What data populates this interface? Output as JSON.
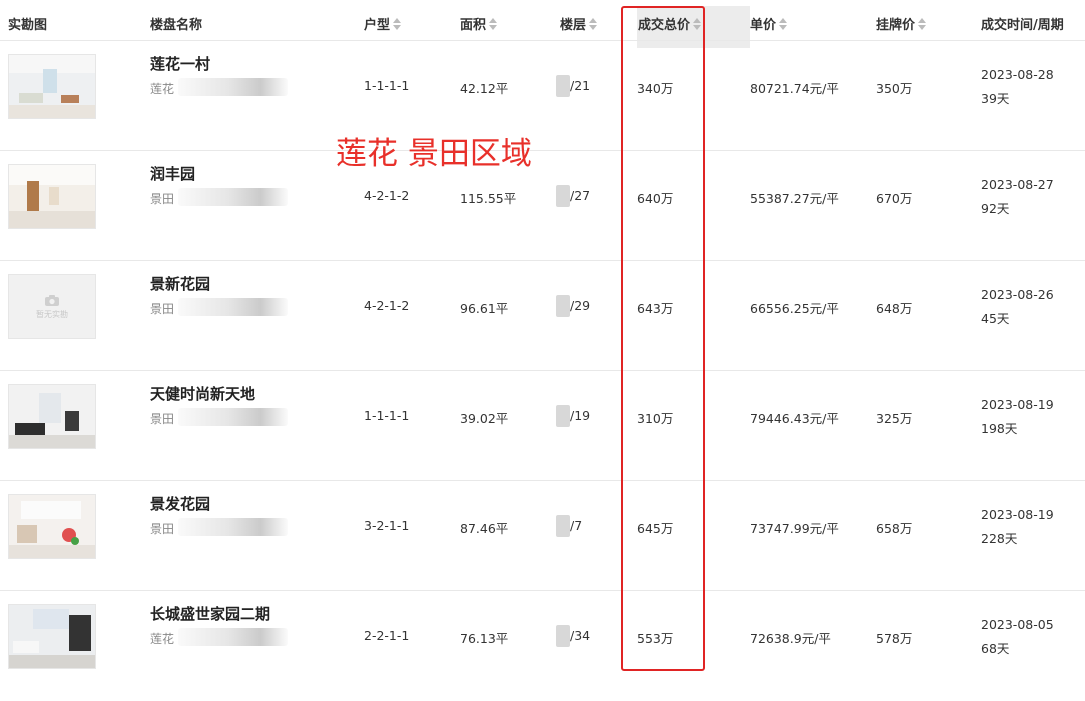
{
  "header": {
    "photo": "实勘图",
    "name": "楼盘名称",
    "layout": "户型",
    "area": "面积",
    "floor": "楼层",
    "total_price": "成交总价",
    "unit_price": "单价",
    "list_price": "挂牌价",
    "deal_time": "成交时间/周期"
  },
  "annotation": "莲花 景田区域",
  "rows": [
    {
      "name": "莲花一村",
      "district": "莲花",
      "layout": "1-1-1-1",
      "area": "42.12平",
      "floor": "/21",
      "total": "340万",
      "unit": "80721.74元/平",
      "list": "350万",
      "date": "2023-08-28",
      "cycle": "39天",
      "photo": "room"
    },
    {
      "name": "润丰园",
      "district": "景田",
      "layout": "4-2-1-2",
      "area": "115.55平",
      "floor": "/27",
      "total": "640万",
      "unit": "55387.27元/平",
      "list": "670万",
      "date": "2023-08-27",
      "cycle": "92天",
      "photo": "room"
    },
    {
      "name": "景新花园",
      "district": "景田",
      "layout": "4-2-1-2",
      "area": "96.61平",
      "floor": "/29",
      "total": "643万",
      "unit": "66556.25元/平",
      "list": "648万",
      "date": "2023-08-26",
      "cycle": "45天",
      "photo": "none",
      "no_photo_text": "暂无实勘"
    },
    {
      "name": "天健时尚新天地",
      "district": "景田",
      "layout": "1-1-1-1",
      "area": "39.02平",
      "floor": "/19",
      "total": "310万",
      "unit": "79446.43元/平",
      "list": "325万",
      "date": "2023-08-19",
      "cycle": "198天",
      "photo": "room"
    },
    {
      "name": "景发花园",
      "district": "景田",
      "layout": "3-2-1-1",
      "area": "87.46平",
      "floor": "/7",
      "total": "645万",
      "unit": "73747.99元/平",
      "list": "658万",
      "date": "2023-08-19",
      "cycle": "228天",
      "photo": "room"
    },
    {
      "name": "长城盛世家园二期",
      "district": "莲花",
      "layout": "2-2-1-1",
      "area": "76.13平",
      "floor": "/34",
      "total": "553万",
      "unit": "72638.9元/平",
      "list": "578万",
      "date": "2023-08-05",
      "cycle": "68天",
      "photo": "room"
    }
  ],
  "colors": {
    "annotation": "#e8302a",
    "box": "#e02424"
  }
}
